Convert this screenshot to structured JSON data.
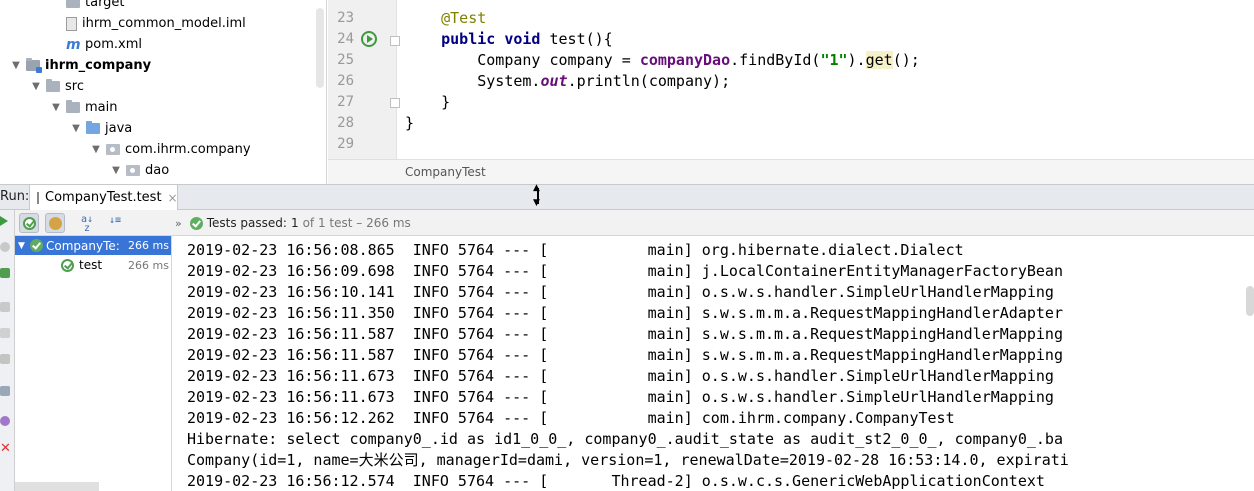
{
  "project_tree": {
    "items": [
      {
        "label": "target",
        "icon": "folder-icon",
        "depth": 2,
        "arrow": "",
        "bold": false
      },
      {
        "label": "ihrm_common_model.iml",
        "icon": "iml-file-icon",
        "depth": 2,
        "arrow": "",
        "bold": false
      },
      {
        "label": "pom.xml",
        "icon": "maven-file-icon",
        "depth": 2,
        "arrow": "",
        "bold": false
      },
      {
        "label": "ihrm_company",
        "icon": "module-folder-icon",
        "depth": 0,
        "arrow": "▼",
        "bold": true
      },
      {
        "label": "src",
        "icon": "folder-icon",
        "depth": 1,
        "arrow": "▼",
        "bold": false
      },
      {
        "label": "main",
        "icon": "folder-icon",
        "depth": 2,
        "arrow": "▼",
        "bold": false
      },
      {
        "label": "java",
        "icon": "source-folder-icon",
        "depth": 3,
        "arrow": "▼",
        "bold": false
      },
      {
        "label": "com.ihrm.company",
        "icon": "package-icon",
        "depth": 4,
        "arrow": "▼",
        "bold": false
      },
      {
        "label": "dao",
        "icon": "package-icon",
        "depth": 5,
        "arrow": "▼",
        "bold": false
      }
    ]
  },
  "editor": {
    "line_numbers": [
      "23",
      "24",
      "25",
      "26",
      "27",
      "28",
      "29"
    ],
    "lines": [
      {
        "n": "23",
        "parts": [
          {
            "t": "    ",
            "c": ""
          },
          {
            "t": "@Test",
            "c": "ann"
          }
        ]
      },
      {
        "n": "24",
        "parts": [
          {
            "t": "    ",
            "c": ""
          },
          {
            "t": "public",
            "c": "kw"
          },
          {
            "t": " ",
            "c": ""
          },
          {
            "t": "void",
            "c": "kw"
          },
          {
            "t": " test(){",
            "c": ""
          }
        ]
      },
      {
        "n": "25",
        "parts": [
          {
            "t": "        Company company = ",
            "c": ""
          },
          {
            "t": "companyDao",
            "c": "fld"
          },
          {
            "t": ".findById(",
            "c": ""
          },
          {
            "t": "\"1\"",
            "c": "str"
          },
          {
            "t": ").",
            "c": ""
          },
          {
            "t": "get",
            "c": "hl"
          },
          {
            "t": "();",
            "c": ""
          }
        ]
      },
      {
        "n": "26",
        "parts": [
          {
            "t": "        System.",
            "c": ""
          },
          {
            "t": "out",
            "c": "fld-i"
          },
          {
            "t": ".println(company);",
            "c": ""
          }
        ]
      },
      {
        "n": "27",
        "parts": [
          {
            "t": "    }",
            "c": ""
          }
        ]
      },
      {
        "n": "28",
        "parts": [
          {
            "t": "}",
            "c": ""
          }
        ]
      },
      {
        "n": "29",
        "parts": []
      }
    ],
    "breadcrumb": "CompanyTest"
  },
  "run_panel": {
    "label": "Run:",
    "tab_title": "CompanyTest.test",
    "tab_close": "×",
    "status_prefix": "Tests passed:",
    "status_count": "1",
    "status_suffix": "of 1 test – 266 ms",
    "test_tree": [
      {
        "label": "CompanyTe:",
        "time": "266 ms"
      },
      {
        "label": "test",
        "time": "266 ms"
      }
    ],
    "console_lines": [
      "2019-02-23 16:56:08.865  INFO 5764 --- [           main] org.hibernate.dialect.Dialect",
      "2019-02-23 16:56:09.698  INFO 5764 --- [           main] j.LocalContainerEntityManagerFactoryBean",
      "2019-02-23 16:56:10.141  INFO 5764 --- [           main] o.s.w.s.handler.SimpleUrlHandlerMapping",
      "2019-02-23 16:56:11.350  INFO 5764 --- [           main] s.w.s.m.m.a.RequestMappingHandlerAdapter",
      "2019-02-23 16:56:11.587  INFO 5764 --- [           main] s.w.s.m.m.a.RequestMappingHandlerMapping",
      "2019-02-23 16:56:11.587  INFO 5764 --- [           main] s.w.s.m.m.a.RequestMappingHandlerMapping",
      "2019-02-23 16:56:11.673  INFO 5764 --- [           main] o.s.w.s.handler.SimpleUrlHandlerMapping",
      "2019-02-23 16:56:11.673  INFO 5764 --- [           main] o.s.w.s.handler.SimpleUrlHandlerMapping",
      "2019-02-23 16:56:12.262  INFO 5764 --- [           main] com.ihrm.company.CompanyTest",
      "Hibernate: select company0_.id as id1_0_0_, company0_.audit_state as audit_st2_0_0_, company0_.ba",
      "Company(id=1, name=大米公司, managerId=dami, version=1, renewalDate=2019-02-28 16:53:14.0, expirati",
      "2019-02-23 16:56:12.574  INFO 5764 --- [       Thread-2] o.s.w.c.s.GenericWebApplicationContext"
    ]
  },
  "colors": {
    "selection": "#3875d7",
    "success": "#5fae5f",
    "keyword": "#000080",
    "annotation": "#808000",
    "field": "#660e7a",
    "string": "#008000"
  }
}
